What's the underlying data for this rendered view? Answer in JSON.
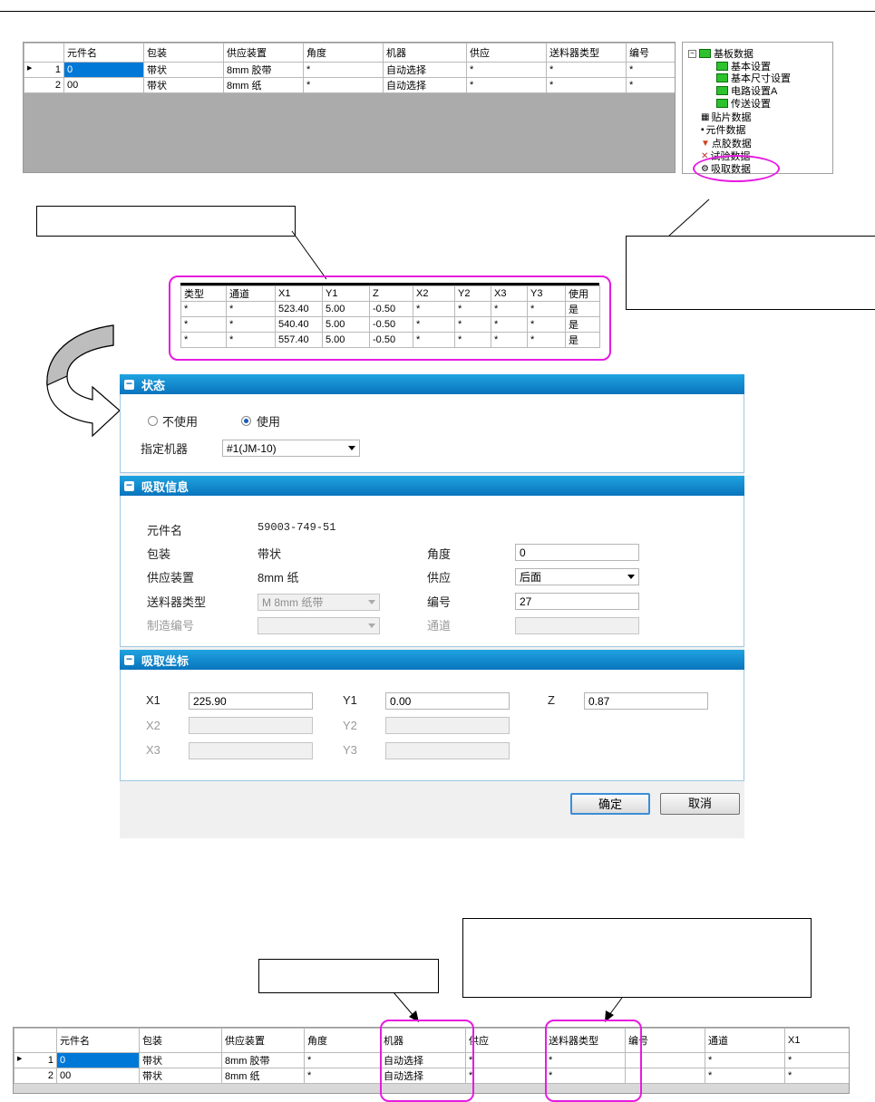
{
  "top_grid": {
    "headers": [
      "元件名",
      "包装",
      "供应装置",
      "角度",
      "机器",
      "供应",
      "送料器类型",
      "编号"
    ],
    "rows": [
      {
        "num": "1",
        "name": "0",
        "pack": "带状",
        "feeder": "8mm 胶带",
        "angle": "*",
        "machine": "自动选择",
        "supply": "*",
        "ftype": "*",
        "no": "*"
      },
      {
        "num": "2",
        "name": "00",
        "pack": "带状",
        "feeder": "8mm 纸",
        "angle": "*",
        "machine": "自动选择",
        "supply": "*",
        "ftype": "*",
        "no": "*"
      }
    ]
  },
  "tree": {
    "root": "基板数据",
    "items": [
      "基本设置",
      "基本尺寸设置",
      "电路设置A",
      "传送设置",
      "贴片数据",
      "元件数据",
      "点胶数据",
      "试验数据",
      "吸取数据"
    ]
  },
  "coord_grid": {
    "headers": [
      "类型",
      "通道",
      "X1",
      "Y1",
      "Z",
      "X2",
      "Y2",
      "X3",
      "Y3",
      "使用"
    ],
    "rows": [
      [
        "*",
        "*",
        "523.40",
        "5.00",
        "-0.50",
        "*",
        "*",
        "*",
        "*",
        "是"
      ],
      [
        "*",
        "*",
        "540.40",
        "5.00",
        "-0.50",
        "*",
        "*",
        "*",
        "*",
        "是"
      ],
      [
        "*",
        "*",
        "557.40",
        "5.00",
        "-0.50",
        "*",
        "*",
        "*",
        "*",
        "是"
      ]
    ]
  },
  "dialog": {
    "status": {
      "title": "状态",
      "unused_label": "不使用",
      "used_label": "使用",
      "selected": "使用",
      "machine_label": "指定机器",
      "machine_value": "#1(JM-10)"
    },
    "pickup_info": {
      "title": "吸取信息",
      "part_name_label": "元件名",
      "part_name_value": "59003-749-51",
      "pack_label": "包装",
      "pack_value": "带状",
      "feeder_label": "供应装置",
      "feeder_value": "8mm 纸",
      "feeder_type_label": "送料器类型",
      "feeder_type_value": "M 8mm 纸带",
      "mfg_no_label": "制造编号",
      "mfg_no_value": "",
      "angle_label": "角度",
      "angle_value": "0",
      "supply_label": "供应",
      "supply_value": "后面",
      "number_label": "编号",
      "number_value": "27",
      "channel_label": "通道",
      "channel_value": ""
    },
    "pickup_coords": {
      "title": "吸取坐标",
      "x1_label": "X1",
      "x1_value": "225.90",
      "y1_label": "Y1",
      "y1_value": "0.00",
      "z_label": "Z",
      "z_value": "0.87",
      "x2_label": "X2",
      "y2_label": "Y2",
      "x3_label": "X3",
      "y3_label": "Y3"
    },
    "ok_label": "确定",
    "cancel_label": "取消"
  },
  "bottom_grid": {
    "headers": [
      "元件名",
      "包装",
      "供应装置",
      "角度",
      "机器",
      "供应",
      "送料器类型",
      "编号",
      "通道",
      "X1"
    ],
    "rows": [
      {
        "num": "1",
        "name": "0",
        "pack": "带状",
        "feeder": "8mm 胶带",
        "angle": "*",
        "machine": "自动选择",
        "supply": "*",
        "ftype": "*",
        "no": "",
        "ch": "*",
        "x1": "*"
      },
      {
        "num": "2",
        "name": "00",
        "pack": "带状",
        "feeder": "8mm 纸",
        "angle": "*",
        "machine": "自动选择",
        "supply": "*",
        "ftype": "*",
        "no": "",
        "ch": "*",
        "x1": "*"
      }
    ]
  },
  "colors": {
    "highlight": "#e61be0",
    "header_blue": "#0a74bd",
    "selection": "#0078d7"
  }
}
